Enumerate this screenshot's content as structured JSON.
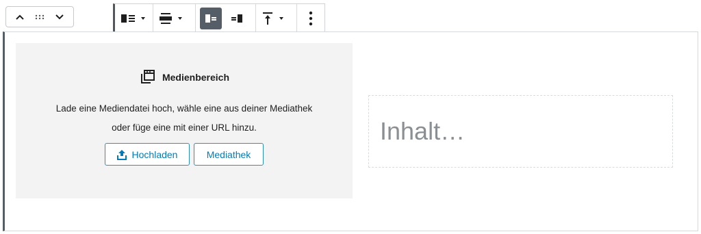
{
  "mover": {
    "up_icon": "chevron-up-icon",
    "drag_icon": "drag-handle-icon",
    "down_icon": "chevron-down-icon"
  },
  "toolbar": {
    "items": [
      {
        "name": "media-position",
        "icon": "media-left-icon",
        "has_dropdown": true
      },
      {
        "name": "vertical-alignment",
        "icon": "align-center-icon",
        "has_dropdown": true
      },
      {
        "name": "show-media-left",
        "icon": "media-left-icon",
        "active": true
      },
      {
        "name": "show-media-right",
        "icon": "media-right-icon",
        "active": false
      },
      {
        "name": "block-alignment",
        "icon": "align-top-icon",
        "has_dropdown": true
      },
      {
        "name": "more-options",
        "icon": "more-vertical-icon"
      }
    ]
  },
  "media_placeholder": {
    "title": "Medienbereich",
    "description_line1": "Lade eine Mediendatei hoch, wähle eine aus deiner Mediathek",
    "description_line2": "oder füge eine mit einer URL hinzu.",
    "upload_label": "Hochladen",
    "library_label": "Mediathek"
  },
  "content_placeholder": "Inhalt…",
  "colors": {
    "accent": "#007cba",
    "toolbar_active": "#555d66",
    "media_bg": "#f3f3f3",
    "placeholder_text": "#8a8f94"
  }
}
